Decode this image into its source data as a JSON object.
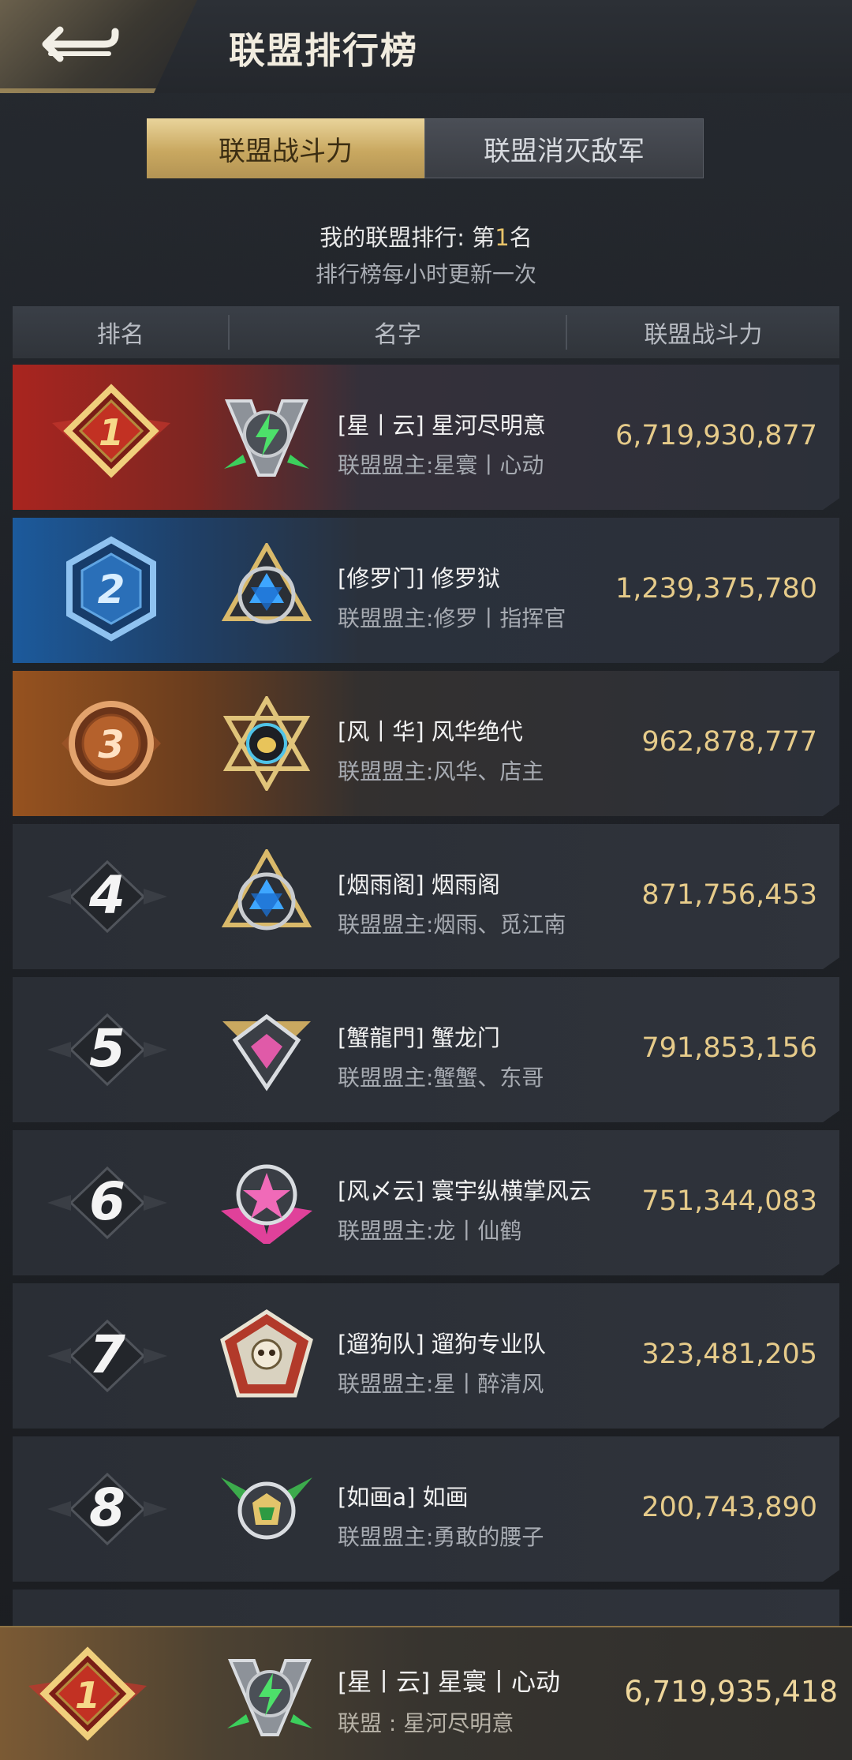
{
  "header": {
    "title": "联盟排行榜"
  },
  "tabs": [
    {
      "label": "联盟战斗力",
      "active": true
    },
    {
      "label": "联盟消灭敌军",
      "active": false
    }
  ],
  "info": {
    "my_rank_prefix": "我的联盟排行: 第",
    "my_rank_value": "1",
    "my_rank_suffix": "名",
    "update_note": "排行榜每小时更新一次"
  },
  "columns": {
    "rank": "排名",
    "name": "名字",
    "power": "联盟战斗力"
  },
  "rows": [
    {
      "rank": "1",
      "name": "[星丨云] 星河尽明意",
      "leader": "联盟盟主:星寰丨心动",
      "power": "6,719,930,877"
    },
    {
      "rank": "2",
      "name": "[修罗门] 修罗狱",
      "leader": "联盟盟主:修罗丨指挥官",
      "power": "1,239,375,780"
    },
    {
      "rank": "3",
      "name": "[风丨华] 风华绝代",
      "leader": "联盟盟主:风华、店主",
      "power": "962,878,777"
    },
    {
      "rank": "4",
      "name": "[烟雨阁] 烟雨阁",
      "leader": "联盟盟主:烟雨、觅江南",
      "power": "871,756,453"
    },
    {
      "rank": "5",
      "name": "[蟹龍門] 蟹龙门",
      "leader": "联盟盟主:蟹蟹、东哥",
      "power": "791,853,156"
    },
    {
      "rank": "6",
      "name": "[风〆云] 寰宇纵横掌风云",
      "leader": "联盟盟主:龙丨仙鹤",
      "power": "751,344,083"
    },
    {
      "rank": "7",
      "name": "[遛狗队] 遛狗专业队",
      "leader": "联盟盟主:星丨醉清风",
      "power": "323,481,205"
    },
    {
      "rank": "8",
      "name": "[如画a] 如画",
      "leader": "联盟盟主:勇敢的腰子",
      "power": "200,743,890"
    }
  ],
  "my_alliance": {
    "rank": "1",
    "name": "[星丨云] 星寰丨心动",
    "leader": "联盟 : 星河尽明意",
    "power": "6,719,935,418"
  },
  "colors": {
    "gold": "#e6cb8a",
    "rank1": "#a9251f",
    "rank2": "#1c5a9c",
    "rank3": "#96521f"
  }
}
